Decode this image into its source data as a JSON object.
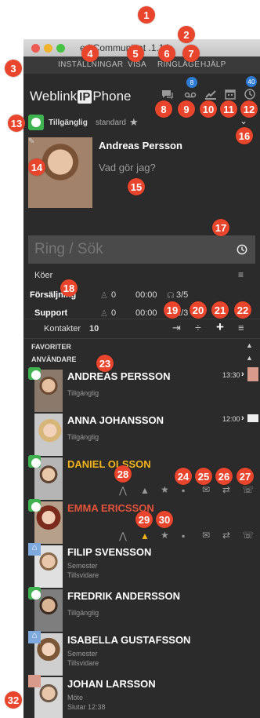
{
  "badges": [
    "1",
    "2",
    "3",
    "4",
    "5",
    "6",
    "7",
    "8",
    "9",
    "10",
    "11",
    "12",
    "13",
    "14",
    "15",
    "16",
    "17",
    "18",
    "19",
    "20",
    "21",
    "22",
    "23",
    "24",
    "25",
    "26",
    "27",
    "28",
    "29",
    "30",
    "32"
  ],
  "window": {
    "title": "Weblink Unified Communicator 5.1.14",
    "title_visible": "ed Communicat  .1.14"
  },
  "menu": [
    {
      "label": "INSTÄLLNINGAR"
    },
    {
      "label": "VISA"
    },
    {
      "label": "RINGLÄGE"
    },
    {
      "label": "HJÄLP"
    }
  ],
  "app": {
    "logo_left": "Weblink",
    "logo_ip": "IP",
    "logo_right": "Phone",
    "voicemail_count": "8",
    "history_count": "40"
  },
  "status": {
    "availability": "Tillgänglig",
    "profile": "standard"
  },
  "profile": {
    "name": "Andreas Persson",
    "activity_prompt": "Vad gör jag?"
  },
  "call": {
    "placeholder": "Ring / Sök"
  },
  "queues": {
    "header": "Köer",
    "rows": [
      {
        "name": "Försäljning",
        "calls": "0",
        "time": "00:00",
        "agents": "3/5"
      },
      {
        "name": "Support",
        "calls": "0",
        "time": "00:00",
        "agents": "2/3"
      }
    ]
  },
  "contacts": {
    "header": "Kontakter",
    "count": "10",
    "favorites_label": "FAVORITER",
    "users_label": "ANVÄNDARE",
    "list": [
      {
        "name": "ANDREAS PERSSON",
        "status1": "Tillgänglig",
        "status2": "",
        "status3": "",
        "time": "13:30",
        "presence": "available",
        "name_color": "#ffffff"
      },
      {
        "name": "ANNA JOHANSSON",
        "status1": "Tillgänglig",
        "status2": "",
        "status3": "",
        "time": "12:00",
        "presence": "available",
        "name_color": "#ffffff"
      },
      {
        "name": "DANIEL OLSSON",
        "status1": "",
        "status2": "",
        "status3": "",
        "time": "",
        "presence": "available",
        "name_color": "#f2b31b"
      },
      {
        "name": "EMMA ERICSSON",
        "status1": "",
        "status2": "",
        "status3": "",
        "time": "",
        "presence": "available",
        "name_color": "#e4533b"
      },
      {
        "name": "FILIP SVENSSON",
        "status1": "Semester",
        "status2": "Tillsvidare",
        "status3": "",
        "time": "",
        "presence": "vacation",
        "name_color": "#ffffff"
      },
      {
        "name": "FREDRIK ANDERSSON",
        "status1": "Tillgänglig",
        "status2": "",
        "status3": "",
        "time": "",
        "presence": "available",
        "name_color": "#ffffff"
      },
      {
        "name": "ISABELLA GUSTAFSSON",
        "status1": "Semester",
        "status2": "Tillsvidare",
        "status3": "",
        "time": "",
        "presence": "vacation",
        "name_color": "#ffffff"
      },
      {
        "name": "JOHAN LARSSON",
        "status1": "Möte",
        "status2": "Slutar 12:38",
        "status3": "",
        "time": "",
        "presence": "meeting",
        "name_color": "#ffffff"
      }
    ]
  },
  "colors": {
    "badge": "#e8452c",
    "available": "#3fb34f",
    "vacation": "#7ea9dc",
    "meeting": "#d89b8b",
    "panel_bg": "#2b2b2b"
  }
}
